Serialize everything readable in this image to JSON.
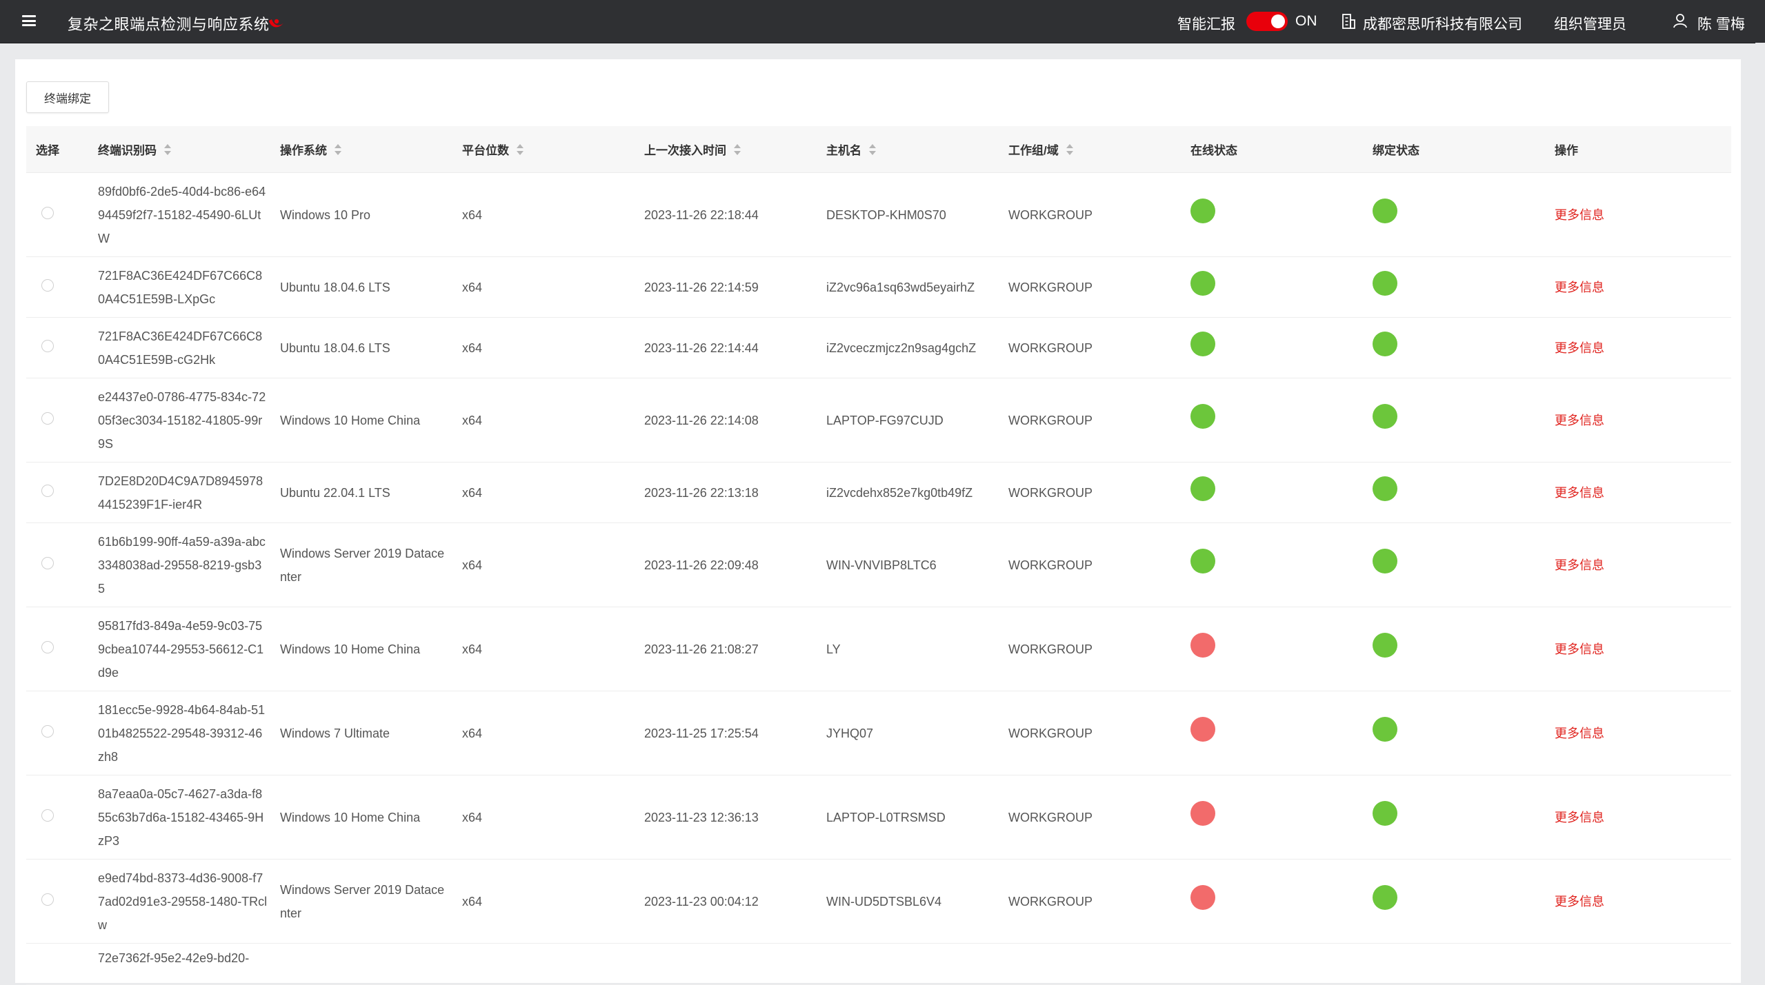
{
  "header": {
    "title": "复杂之眼端点检测与响应系统",
    "ai_report_label": "智能汇报",
    "toggle_state": "ON",
    "company": "成都密思听科技有限公司",
    "role": "组织管理员",
    "user": "陈 雪梅",
    "accent_color": "#e8000b",
    "icons": [
      "menu-icon",
      "logo-icon",
      "building-icon",
      "user-icon"
    ]
  },
  "toolbar": {
    "bind_button": "终端绑定"
  },
  "table": {
    "headers": {
      "select": "选择",
      "id": "终端识别码",
      "os": "操作系统",
      "arch": "平台位数",
      "last_access": "上一次接入时间",
      "hostname": "主机名",
      "workgroup": "工作组/域",
      "online": "在线状态",
      "bind": "绑定状态",
      "action": "操作"
    },
    "status_colors": {
      "online": "#6cc63b",
      "offline": "#f26b6b"
    },
    "rows": [
      {
        "id": "89fd0bf6-2de5-40d4-bc86-e6494459f2f7-15182-45490-6LUtW",
        "os": "Windows 10 Pro",
        "arch": "x64",
        "time": "2023-11-26 22:18:44",
        "host": "DESKTOP-KHM0S70",
        "group": "WORKGROUP",
        "online": "green",
        "bind": "green",
        "action": "更多信息"
      },
      {
        "id": "721F8AC36E424DF67C66C80A4C51E59B-LXpGc",
        "os": "Ubuntu 18.04.6 LTS",
        "arch": "x64",
        "time": "2023-11-26 22:14:59",
        "host": "iZ2vc96a1sq63wd5eyairhZ",
        "group": "WORKGROUP",
        "online": "green",
        "bind": "green",
        "action": "更多信息"
      },
      {
        "id": "721F8AC36E424DF67C66C80A4C51E59B-cG2Hk",
        "os": "Ubuntu 18.04.6 LTS",
        "arch": "x64",
        "time": "2023-11-26 22:14:44",
        "host": "iZ2vceczmjcz2n9sag4gchZ",
        "group": "WORKGROUP",
        "online": "green",
        "bind": "green",
        "action": "更多信息"
      },
      {
        "id": "e24437e0-0786-4775-834c-7205f3ec3034-15182-41805-99r9S",
        "os": "Windows 10 Home China",
        "arch": "x64",
        "time": "2023-11-26 22:14:08",
        "host": "LAPTOP-FG97CUJD",
        "group": "WORKGROUP",
        "online": "green",
        "bind": "green",
        "action": "更多信息"
      },
      {
        "id": "7D2E8D20D4C9A7D89459784415239F1F-ier4R",
        "os": "Ubuntu 22.04.1 LTS",
        "arch": "x64",
        "time": "2023-11-26 22:13:18",
        "host": "iZ2vcdehx852e7kg0tb49fZ",
        "group": "WORKGROUP",
        "online": "green",
        "bind": "green",
        "action": "更多信息"
      },
      {
        "id": "61b6b199-90ff-4a59-a39a-abc3348038ad-29558-8219-gsb35",
        "os": "Windows Server 2019 Datacenter",
        "arch": "x64",
        "time": "2023-11-26 22:09:48",
        "host": "WIN-VNVIBP8LTC6",
        "group": "WORKGROUP",
        "online": "green",
        "bind": "green",
        "action": "更多信息"
      },
      {
        "id": "95817fd3-849a-4e59-9c03-759cbea10744-29553-56612-C1d9e",
        "os": "Windows 10 Home China",
        "arch": "x64",
        "time": "2023-11-26 21:08:27",
        "host": "LY",
        "group": "WORKGROUP",
        "online": "red",
        "bind": "green",
        "action": "更多信息"
      },
      {
        "id": "181ecc5e-9928-4b64-84ab-5101b4825522-29548-39312-46zh8",
        "os": "Windows 7 Ultimate",
        "arch": "x64",
        "time": "2023-11-25 17:25:54",
        "host": "JYHQ07",
        "group": "WORKGROUP",
        "online": "red",
        "bind": "green",
        "action": "更多信息"
      },
      {
        "id": "8a7eaa0a-05c7-4627-a3da-f855c63b7d6a-15182-43465-9HzP3",
        "os": "Windows 10 Home China",
        "arch": "x64",
        "time": "2023-11-23 12:36:13",
        "host": "LAPTOP-L0TRSMSD",
        "group": "WORKGROUP",
        "online": "red",
        "bind": "green",
        "action": "更多信息"
      },
      {
        "id": "e9ed74bd-8373-4d36-9008-f77ad02d91e3-29558-1480-TRclw",
        "os": "Windows Server 2019 Datacenter",
        "arch": "x64",
        "time": "2023-11-23 00:04:12",
        "host": "WIN-UD5DTSBL6V4",
        "group": "WORKGROUP",
        "online": "red",
        "bind": "green",
        "action": "更多信息"
      },
      {
        "id": "72e7362f-95e2-42e9-bd20-",
        "os": "",
        "arch": "",
        "time": "",
        "host": "",
        "group": "",
        "online": "",
        "bind": "",
        "action": ""
      }
    ]
  }
}
